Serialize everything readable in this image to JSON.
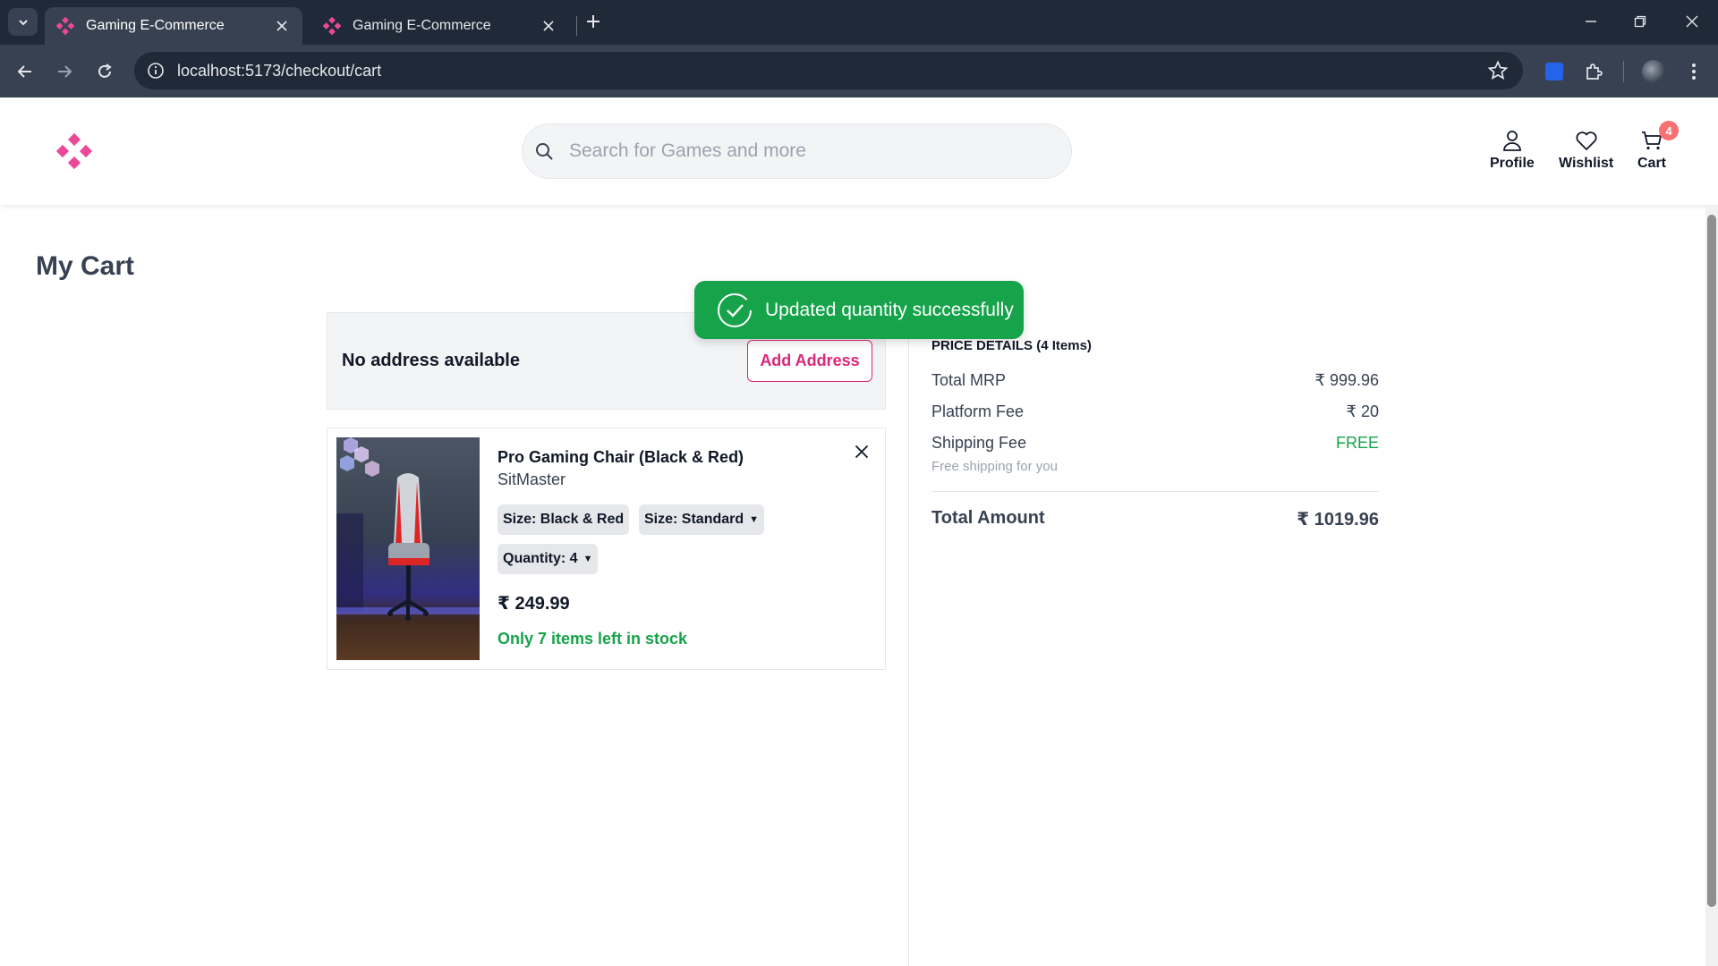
{
  "browser": {
    "tabs": [
      {
        "title": "Gaming E-Commerce",
        "active": true
      },
      {
        "title": "Gaming E-Commerce",
        "active": false
      }
    ],
    "url": "localhost:5173/checkout/cart"
  },
  "header": {
    "search_placeholder": "Search for Games and more",
    "nav": {
      "profile": "Profile",
      "wishlist": "Wishlist",
      "cart": "Cart",
      "cart_count": "4"
    }
  },
  "page": {
    "title": "My Cart"
  },
  "address": {
    "message": "No address available",
    "add_button": "Add Address"
  },
  "cart_items": [
    {
      "name": "Pro Gaming Chair (Black & Red)",
      "brand": "SitMaster",
      "color_chip": "Size: Black & Red",
      "size_chip": "Size: Standard",
      "quantity_chip": "Quantity: 4",
      "price": "₹ 249.99",
      "stock": "Only 7 items left in stock"
    }
  ],
  "price_details": {
    "heading": "PRICE DETAILS (4 Items)",
    "rows": [
      {
        "label": "Total MRP",
        "value": "₹ 999.96"
      },
      {
        "label": "Platform Fee",
        "value": "₹ 20"
      },
      {
        "label": "Shipping Fee",
        "value": "FREE"
      }
    ],
    "shipping_note": "Free shipping for you",
    "total_label": "Total Amount",
    "total_value": "₹ 1019.96"
  },
  "toast": {
    "message": "Updated quantity successfully"
  },
  "colors": {
    "brand": "#db2777",
    "success": "#16a34a",
    "badge": "#f87171"
  }
}
